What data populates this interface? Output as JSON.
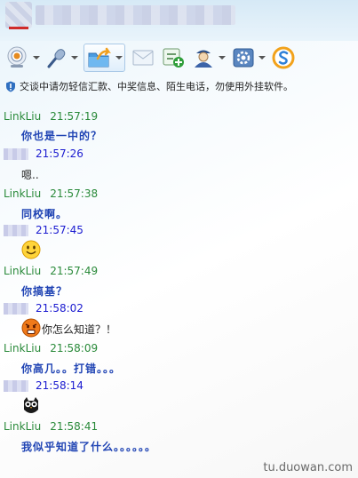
{
  "toolbar": {
    "buttons": [
      {
        "icon": "webcam-icon",
        "has_menu": true
      },
      {
        "icon": "microphone-icon",
        "has_menu": true
      },
      {
        "icon": "send-file-icon",
        "has_menu": true,
        "active": true
      },
      {
        "icon": "message-icon",
        "has_menu": false
      },
      {
        "icon": "add-contact-icon",
        "has_menu": false
      },
      {
        "icon": "user-card-icon",
        "has_menu": true
      },
      {
        "icon": "app-settings-icon",
        "has_menu": true
      },
      {
        "icon": "search-s-icon",
        "has_menu": false
      }
    ]
  },
  "notice": {
    "text": "交谈中请勿轻信汇款、中奖信息、陌生电话，勿使用外挂软件。"
  },
  "chat": {
    "peer_name": "LinkLiu",
    "messages": [
      {
        "from": "peer",
        "time": "21:57:19",
        "text": "你也是一中的？"
      },
      {
        "from": "me",
        "time": "21:57:26",
        "text": "嗯.."
      },
      {
        "from": "peer",
        "time": "21:57:38",
        "text": "同校啊。"
      },
      {
        "from": "me",
        "time": "21:57:45",
        "emoji": "smile-emoji"
      },
      {
        "from": "peer",
        "time": "21:57:49",
        "text": "你搞基？"
      },
      {
        "from": "me",
        "time": "21:58:02",
        "emoji": "shocked-emoji",
        "text": "你怎么知道？！"
      },
      {
        "from": "peer",
        "time": "21:58:09",
        "text": "你高几。。打错。。。"
      },
      {
        "from": "me",
        "time": "21:58:14",
        "emoji": "owl-emoji"
      },
      {
        "from": "peer",
        "time": "21:58:41",
        "text": "我似乎知道了什么。。。。。。"
      }
    ]
  },
  "watermark": "tu.duowan.com",
  "colors": {
    "peer_header": "#2a8a3a",
    "me_header": "#1b1bd0",
    "peer_text": "#2044b4"
  }
}
